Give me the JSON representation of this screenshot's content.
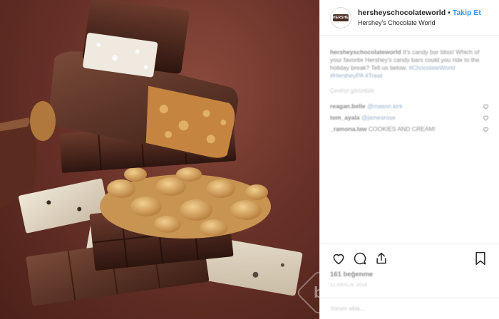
{
  "photo": {
    "alt": "Hershey's chocolate bars stacked"
  },
  "header": {
    "avatar_logo": "HERSHEY'S",
    "username": "hersheyschocolateworld",
    "separator": "•",
    "follow_label": "Takip Et",
    "location": "Hershey's Chocolate World"
  },
  "caption": {
    "user": "hersheyschocolateworld",
    "text": "It's candy bar bliss! Which of your favorite Hershey's candy bars could you ride to the holiday break? Tell us below.",
    "tags": "#ChocolateWorld #HersheyPA #Treat"
  },
  "translate_label": "Çeviriyi görüntüle",
  "comments": [
    {
      "user": "reagan.belle",
      "text": "@mason.kirk"
    },
    {
      "user": "tom_ayala",
      "text": "@jamesrose"
    },
    {
      "user": "_ramona.law",
      "text": "COOKIES AND CREAM!"
    }
  ],
  "footer": {
    "likes": "161 beğenme",
    "date": "12 ARALIK 2018",
    "add_comment": "Yorum ekle..."
  },
  "watermark": "b",
  "colors": {
    "follow": "#3897f0",
    "border": "#efefef",
    "chocolate": "#4a2c22"
  }
}
